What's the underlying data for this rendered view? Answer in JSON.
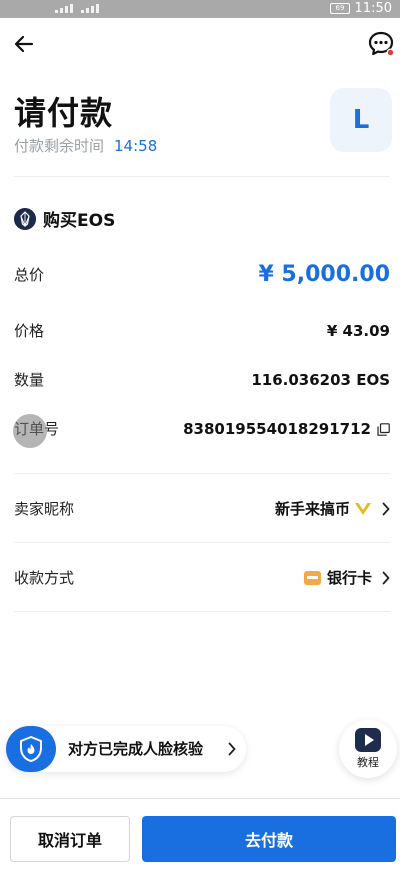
{
  "statusbar": {
    "time": "11:50",
    "battery": "69"
  },
  "header": {
    "back_icon": "arrow-left-icon",
    "chat_icon": "chat-bubble-icon"
  },
  "page": {
    "title": "请付款",
    "remaining_label": "付款剩余时间",
    "remaining_time": "14:58",
    "avatar_letter": "L"
  },
  "asset": {
    "title": "购买EOS",
    "icon": "eos-coin-icon"
  },
  "details": {
    "total_label": "总价",
    "total_value": "¥ 5,000.00",
    "price_label": "价格",
    "price_value": "¥ 43.09",
    "qty_label": "数量",
    "qty_value": "116.036203 EOS",
    "order_label": "订单号",
    "order_value": "838019554018291712"
  },
  "seller": {
    "label": "卖家昵称",
    "value": "新手来搞币"
  },
  "payment": {
    "label": "收款方式",
    "value": "银行卡"
  },
  "verify": {
    "text": "对方已完成人脸核验"
  },
  "tutorial": {
    "label": "教程"
  },
  "buttons": {
    "cancel": "取消订单",
    "pay": "去付款"
  },
  "colors": {
    "accent": "#1a6fe0",
    "muted": "#9aa0a6",
    "card": "#f0a849",
    "badge": "#e8b820"
  }
}
